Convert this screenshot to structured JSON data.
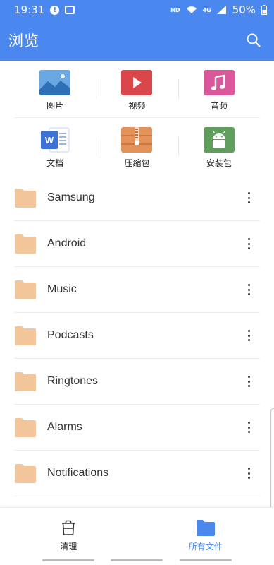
{
  "status_bar": {
    "time": "19:31",
    "hd": "HD",
    "network": "4G",
    "battery": "50%"
  },
  "app_bar": {
    "title": "浏览",
    "search_icon": "search-icon"
  },
  "categories": [
    {
      "label": "图片",
      "icon": "image-icon",
      "color": "#5b9bd5"
    },
    {
      "label": "视频",
      "icon": "video-icon",
      "color": "#d9474a"
    },
    {
      "label": "音频",
      "icon": "music-icon",
      "color": "#d9579a"
    },
    {
      "label": "文档",
      "icon": "word-doc-icon",
      "color": "#3d73d6"
    },
    {
      "label": "压缩包",
      "icon": "zip-archive-icon",
      "color": "#e08a4c"
    },
    {
      "label": "安装包",
      "icon": "android-apk-icon",
      "color": "#5f9e5c"
    }
  ],
  "folders": [
    {
      "name": "Samsung"
    },
    {
      "name": "Android"
    },
    {
      "name": "Music"
    },
    {
      "name": "Podcasts"
    },
    {
      "name": "Ringtones"
    },
    {
      "name": "Alarms"
    },
    {
      "name": "Notifications"
    }
  ],
  "bottom_nav": [
    {
      "label": "清理",
      "icon": "trash-clean-icon",
      "active": false
    },
    {
      "label": "所有文件",
      "icon": "folder-icon",
      "active": true
    }
  ],
  "colors": {
    "primary": "#4a88ef",
    "folder": "#f2c69a"
  }
}
